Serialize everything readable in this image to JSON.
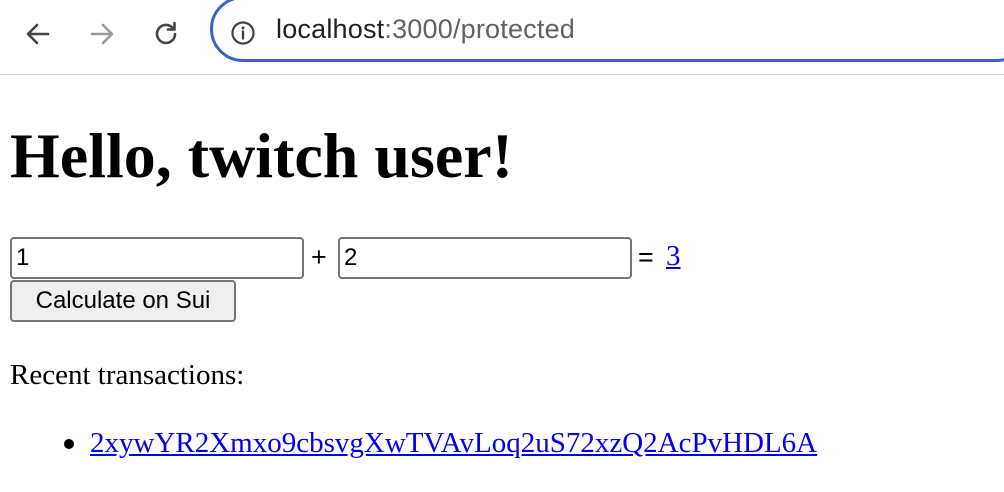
{
  "browser": {
    "url_host": "localhost",
    "url_path": ":3000/protected",
    "back_icon": "arrow-left-icon",
    "forward_icon": "arrow-right-icon",
    "reload_icon": "reload-icon",
    "site_info_icon": "info-circle-icon"
  },
  "page": {
    "heading": "Hello, twitch user!",
    "calculator": {
      "a_value": "1",
      "plus": "+",
      "b_value": "2",
      "equals": "=",
      "result": "3",
      "button_label": "Calculate on Sui"
    },
    "recent_label": "Recent transactions:",
    "transactions": [
      "2xywYR2Xmxo9cbsvgXwTVAvLoq2uS72xzQ2AcPvHDL6A"
    ]
  },
  "colors": {
    "link": "#0000ee",
    "omnibox_focus": "#3b63c7"
  }
}
